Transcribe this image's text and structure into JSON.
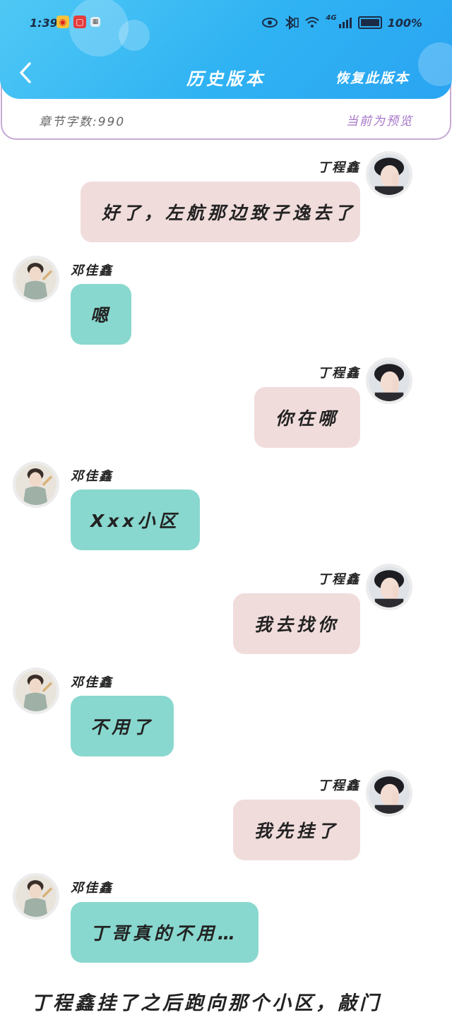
{
  "status_bar": {
    "time": "1:39",
    "network": "4G",
    "battery": "100%"
  },
  "header": {
    "title": "历史版本",
    "restore_label": "恢复此版本"
  },
  "info": {
    "char_count": "章节字数:990",
    "preview_label": "当前为预览"
  },
  "messages": [
    {
      "side": "right",
      "sender": "丁程鑫",
      "text": "好了，左航那边致子逸去了"
    },
    {
      "side": "left",
      "sender": "邓佳鑫",
      "text": "嗯"
    },
    {
      "side": "right",
      "sender": "丁程鑫",
      "text": "你在哪"
    },
    {
      "side": "left",
      "sender": "邓佳鑫",
      "text": "Xxx小区"
    },
    {
      "side": "right",
      "sender": "丁程鑫",
      "text": "我去找你"
    },
    {
      "side": "left",
      "sender": "邓佳鑫",
      "text": "不用了"
    },
    {
      "side": "right",
      "sender": "丁程鑫",
      "text": "我先挂了"
    },
    {
      "side": "left",
      "sender": "邓佳鑫",
      "text": "丁哥真的不用…"
    }
  ],
  "narration": "丁程鑫挂了之后跑向那个小区，敲门",
  "colors": {
    "header": "#2fb2f3",
    "pink_bubble": "#f1dcdc",
    "teal_bubble": "#89d8cf",
    "preview_text": "#a574c9"
  }
}
